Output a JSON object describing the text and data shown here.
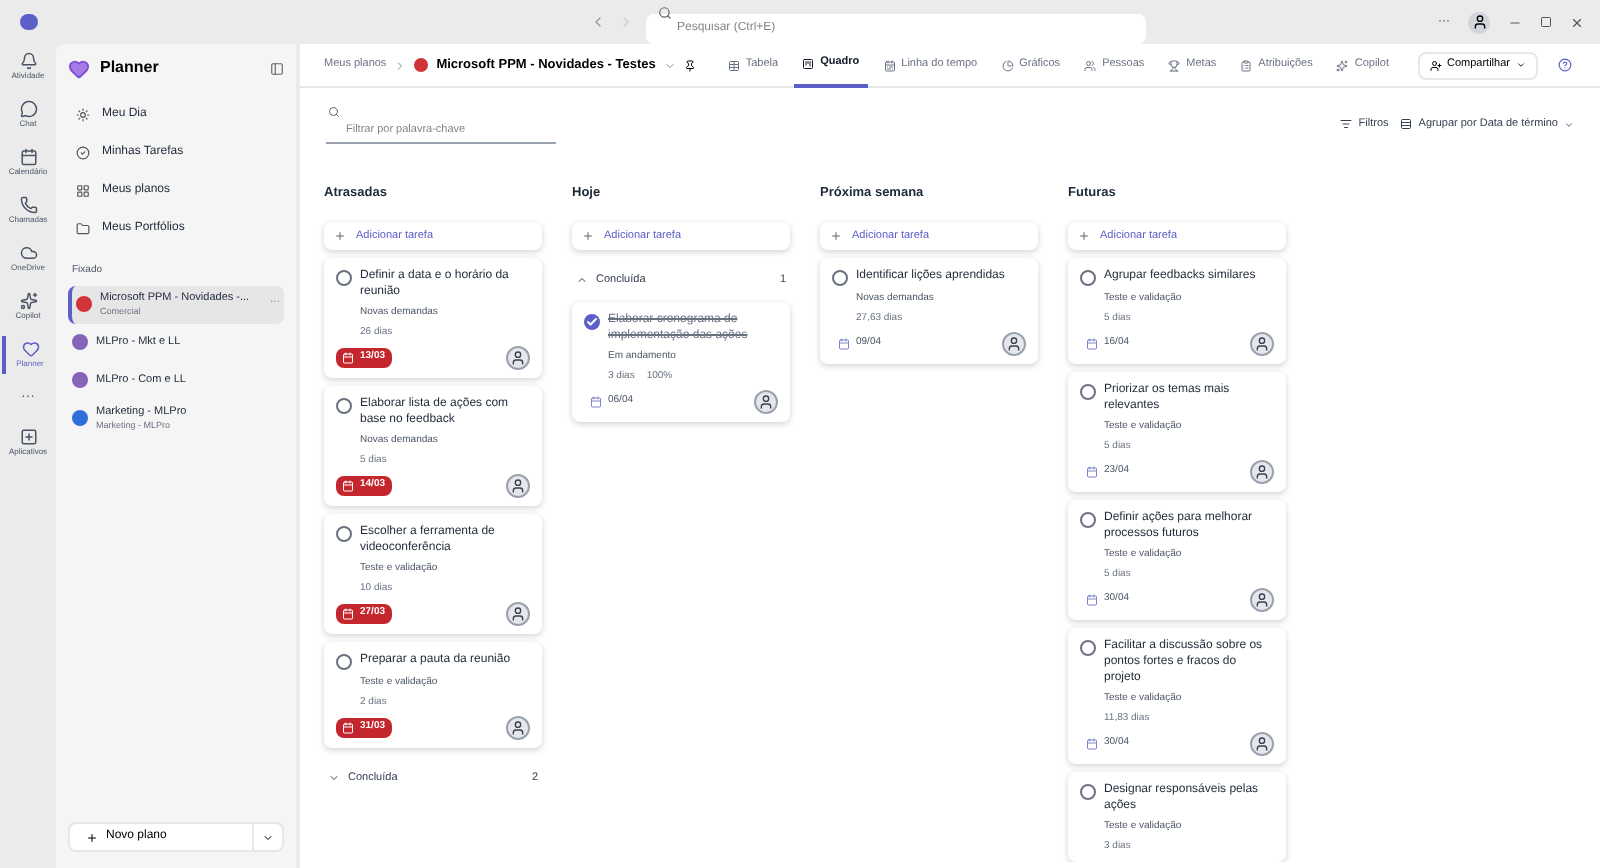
{
  "titlebar": {
    "search_placeholder": "Pesquisar (Ctrl+E)",
    "more": "···"
  },
  "rail": [
    {
      "label": "Atividade",
      "selected": false
    },
    {
      "label": "Chat",
      "selected": false
    },
    {
      "label": "Calendário",
      "selected": false
    },
    {
      "label": "Chamadas",
      "selected": false
    },
    {
      "label": "OneDrive",
      "selected": false
    },
    {
      "label": "Copilot",
      "selected": false
    },
    {
      "label": "Planner",
      "selected": true
    },
    {
      "label": "···",
      "selected": false
    },
    {
      "label": "Aplicativos",
      "selected": false
    }
  ],
  "sidebar": {
    "title": "Planner",
    "items": [
      {
        "label": "Meu Dia"
      },
      {
        "label": "Minhas Tarefas"
      },
      {
        "label": "Meus planos"
      },
      {
        "label": "Meus Portfólios"
      }
    ],
    "section": "Fixado",
    "pinned": [
      {
        "name": "Microsoft PPM - Novidades -...",
        "subtitle": "Comercial",
        "color": "#d13438",
        "selected": true,
        "more": "···"
      },
      {
        "name": "MLPro - Mkt e LL",
        "color": "#8764b8",
        "selected": false
      },
      {
        "name": "MLPro - Com e LL",
        "color": "#8764b8",
        "selected": false
      },
      {
        "name": "Marketing - MLPro",
        "subtitle": "Marketing - MLPro",
        "color": "#2f6fdb",
        "selected": false
      }
    ],
    "new_plan": "Novo plano"
  },
  "header": {
    "breadcrumb": "Meus planos",
    "plan": "Microsoft PPM - Novidades - Testes",
    "tabs": [
      {
        "label": "Tabela",
        "selected": false
      },
      {
        "label": "Quadro",
        "selected": true
      },
      {
        "label": "Linha do tempo",
        "selected": false
      },
      {
        "label": "Gráficos",
        "selected": false
      },
      {
        "label": "Pessoas",
        "selected": false
      },
      {
        "label": "Metas",
        "selected": false
      },
      {
        "label": "Atribuições",
        "selected": false
      },
      {
        "label": "Copilot",
        "selected": false
      }
    ],
    "share": "Compartilhar"
  },
  "toolbar": {
    "filter_placeholder": "Filtrar por palavra-chave",
    "filters": "Filtros",
    "group_by": "Agrupar por Data de término"
  },
  "columns": [
    {
      "title": "Atrasadas",
      "add": "Adicionar tarefa",
      "tasks": [
        {
          "title": "Definir a data e o horário da reunião",
          "bucket": "Novas demandas",
          "duration": "26 dias",
          "date": "13/03",
          "overdue": true,
          "checked": false
        },
        {
          "title": "Elaborar lista de ações com base no feedback",
          "bucket": "Novas demandas",
          "duration": "5 dias",
          "date": "14/03",
          "overdue": true,
          "checked": false
        },
        {
          "title": "Escolher a ferramenta de videoconferência",
          "bucket": "Teste e validação",
          "duration": "10 dias",
          "date": "27/03",
          "overdue": true,
          "checked": false
        },
        {
          "title": "Preparar a pauta da reunião",
          "bucket": "Teste e validação",
          "duration": "2 dias",
          "date": "31/03",
          "overdue": true,
          "checked": false
        }
      ],
      "completed": {
        "label": "Concluída",
        "count": "2",
        "expanded": false
      }
    },
    {
      "title": "Hoje",
      "add": "Adicionar tarefa",
      "completed": {
        "label": "Concluída",
        "count": "1",
        "expanded": true,
        "tasks": [
          {
            "title": "Elaborar cronograma de implementação das ações",
            "bucket": "Em andamento",
            "duration": "3 dias",
            "progress": "100%",
            "date": "06/04",
            "overdue": false,
            "checked": true
          }
        ]
      }
    },
    {
      "title": "Próxima semana",
      "add": "Adicionar tarefa",
      "tasks": [
        {
          "title": "Identificar lições aprendidas",
          "bucket": "Novas demandas",
          "duration": "27,63 dias",
          "date": "09/04",
          "overdue": false,
          "checked": false
        }
      ]
    },
    {
      "title": "Futuras",
      "add": "Adicionar tarefa",
      "tasks": [
        {
          "title": "Agrupar feedbacks similares",
          "bucket": "Teste e validação",
          "duration": "5 dias",
          "date": "16/04",
          "overdue": false,
          "checked": false
        },
        {
          "title": "Priorizar os temas mais relevantes",
          "bucket": "Teste e validação",
          "duration": "5 dias",
          "date": "23/04",
          "overdue": false,
          "checked": false
        },
        {
          "title": "Definir ações para melhorar processos futuros",
          "bucket": "Teste e validação",
          "duration": "5 dias",
          "date": "30/04",
          "overdue": false,
          "checked": false
        },
        {
          "title": "Facilitar a discussão sobre os pontos fortes e fracos do projeto",
          "bucket": "Teste e validação",
          "duration": "11,83 dias",
          "date": "30/04",
          "overdue": false,
          "checked": false
        },
        {
          "title": "Designar responsáveis pelas ações",
          "bucket": "Teste e validação",
          "duration": "3 dias",
          "checked": false
        }
      ]
    }
  ]
}
